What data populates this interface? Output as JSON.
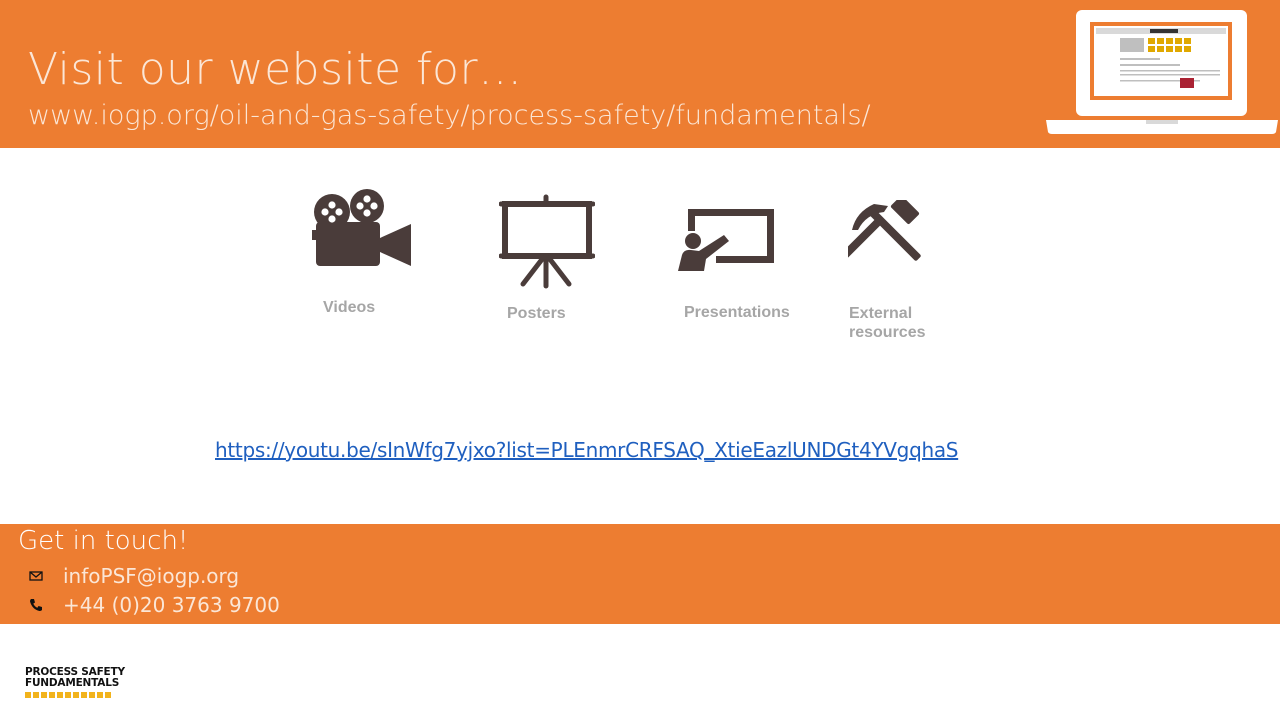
{
  "header": {
    "title": "Visit our website for…",
    "url": "www.iogp.org/oil-and-gas-safety/process-safety/fundamentals/"
  },
  "resources": [
    {
      "label": "Videos",
      "icon": "video-camera-icon"
    },
    {
      "label": "Posters",
      "icon": "poster-easel-icon"
    },
    {
      "label": "Presentations",
      "icon": "presentation-board-icon"
    },
    {
      "label": "External resources",
      "label_line1": "External",
      "label_line2": "resources",
      "icon": "hammer-pickaxe-icon"
    }
  ],
  "video_link": "https://youtu.be/sInWfg7yjxo?list=PLEnmrCRFSAQ_XtieEazlUNDGt4YVgqhaS",
  "footer": {
    "title": "Get in touch!",
    "email": "infoPSF@iogp.org",
    "phone": "+44 (0)20 3763 9700"
  },
  "logo": {
    "line1": "PROCESS SAFETY",
    "line2": "FUNDAMENTALS"
  },
  "colors": {
    "accent": "#ED7D31",
    "icon": "#4a3c3a",
    "label": "#a6a6a6",
    "link": "#1f5fbf",
    "logo_squares": "#f2b31b"
  }
}
